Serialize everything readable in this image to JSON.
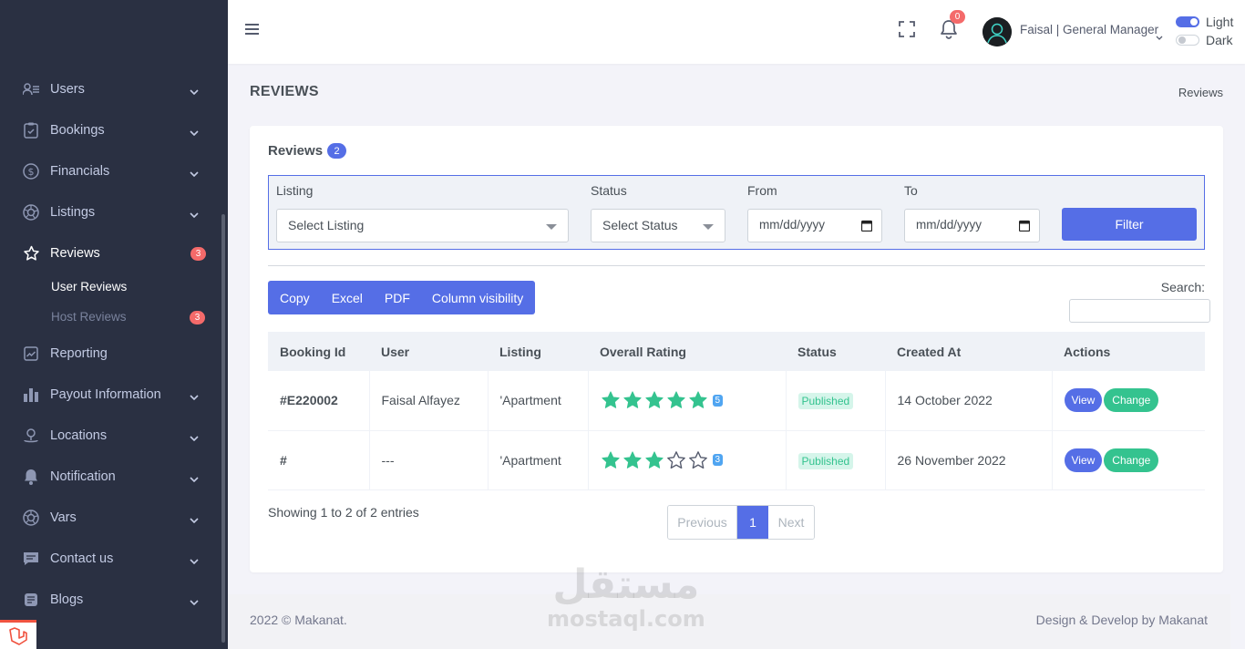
{
  "sidebar": {
    "items": [
      {
        "label": "Users",
        "icon": "users-icon"
      },
      {
        "label": "Bookings",
        "icon": "clipboard-icon"
      },
      {
        "label": "Financials",
        "icon": "dollar-icon"
      },
      {
        "label": "Listings",
        "icon": "aperture-icon"
      },
      {
        "label": "Reviews",
        "icon": "star-icon",
        "badge": "3"
      },
      {
        "label": "Reporting",
        "icon": "chart-line-icon"
      },
      {
        "label": "Payout Information",
        "icon": "bar-chart-icon"
      },
      {
        "label": "Locations",
        "icon": "map-pin-icon"
      },
      {
        "label": "Notification",
        "icon": "bell-icon"
      },
      {
        "label": "Vars",
        "icon": "aperture-icon"
      },
      {
        "label": "Contact us",
        "icon": "chat-icon"
      },
      {
        "label": "Blogs",
        "icon": "database-icon"
      }
    ],
    "sub_items": [
      {
        "label": "User Reviews"
      },
      {
        "label": "Host Reviews",
        "badge": "3"
      }
    ]
  },
  "topbar": {
    "notification_count": "0",
    "user_name": "Faisal | General Manager",
    "theme_light": "Light",
    "theme_dark": "Dark"
  },
  "page": {
    "title": "REVIEWS",
    "breadcrumb": "Reviews"
  },
  "card": {
    "title": "Reviews",
    "count": "2"
  },
  "filters": {
    "listing_label": "Listing",
    "listing_value": "Select Listing",
    "status_label": "Status",
    "status_value": "Select Status",
    "from_label": "From",
    "from_placeholder": "mm/dd/yyyy",
    "to_label": "To",
    "to_placeholder": "mm/dd/yyyy",
    "filter_button": "Filter"
  },
  "export_buttons": [
    "Copy",
    "Excel",
    "PDF",
    "Column visibility"
  ],
  "search_label": "Search:",
  "table": {
    "headers": [
      "Booking Id",
      "User",
      "Listing",
      "Overall Rating",
      "Status",
      "Created At",
      "Actions"
    ],
    "rows": [
      {
        "booking_id": "#E220002",
        "user": "Faisal Alfayez",
        "listing": "'Apartment",
        "rating": 5,
        "rating_label": "5",
        "status": "Published",
        "created_at": "14 October 2022",
        "view": "View",
        "change": "Change"
      },
      {
        "booking_id": "#",
        "user": "---",
        "listing": "'Apartment",
        "rating": 3,
        "rating_label": "3",
        "status": "Published",
        "created_at": "26 November 2022",
        "view": "View",
        "change": "Change"
      }
    ]
  },
  "pagination": {
    "info": "Showing 1 to 2 of 2 entries",
    "previous": "Previous",
    "current": "1",
    "next": "Next"
  },
  "footer": {
    "left": "2022 © Makanat.",
    "right": "Design & Develop by Makanat"
  },
  "watermark": {
    "arabic": "مستقل",
    "latin": "mostaql.com"
  },
  "colors": {
    "primary": "#556ee6",
    "success": "#34c38f",
    "danger": "#f46a6a",
    "sidebar": "#2a3042",
    "star": "#34c38f"
  }
}
